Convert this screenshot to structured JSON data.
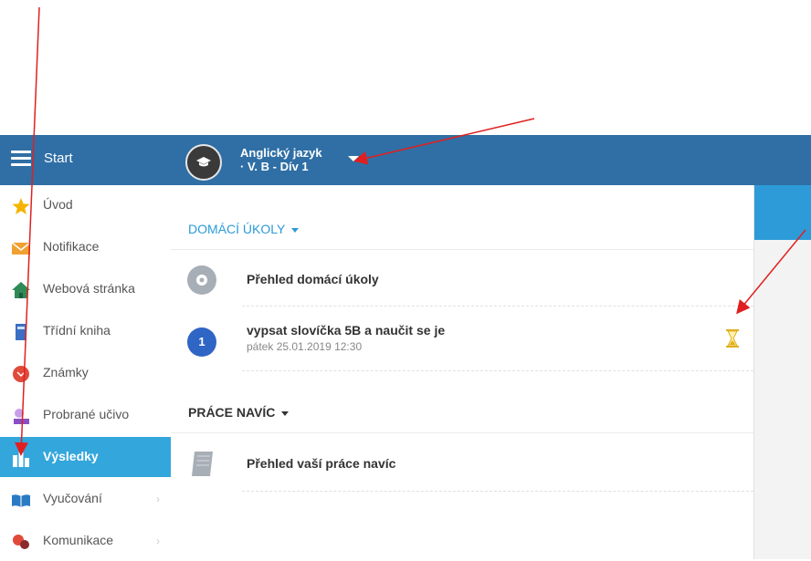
{
  "topbar": {
    "start_label": "Start",
    "course_title_line1": "Anglický jazyk",
    "course_title_line2": "· V. B - Dív 1"
  },
  "sidebar": {
    "items": [
      {
        "label": "Úvod",
        "icon": "star-icon"
      },
      {
        "label": "Notifikace",
        "icon": "envelope-icon"
      },
      {
        "label": "Webová stránka",
        "icon": "house-icon"
      },
      {
        "label": "Třídní kniha",
        "icon": "book-icon"
      },
      {
        "label": "Známky",
        "icon": "grades-icon"
      },
      {
        "label": "Probrané učivo",
        "icon": "topics-icon"
      },
      {
        "label": "Výsledky",
        "icon": "bar-chart-icon",
        "active": true
      },
      {
        "label": "Vyučování",
        "icon": "open-book-icon"
      },
      {
        "label": "Komunikace",
        "icon": "chat-icon"
      }
    ]
  },
  "homework": {
    "header": "DOMÁCÍ ÚKOLY",
    "overview": "Přehled domácí úkoly",
    "items": [
      {
        "badge": "1",
        "title": "vypsat slovíčka 5B a naučit se je",
        "due": "pátek 25.01.2019 12:30",
        "status_icon": "hourglass-icon"
      }
    ]
  },
  "extra_work": {
    "header": "PRÁCE NAVÍC",
    "overview": "Přehled vaší práce navíc"
  },
  "colors": {
    "topbar": "#2f6fa5",
    "active_item": "#33a6dc",
    "accent": "#2d9bd8",
    "badge": "#2f65c4",
    "annotation_arrow": "#e02020"
  }
}
